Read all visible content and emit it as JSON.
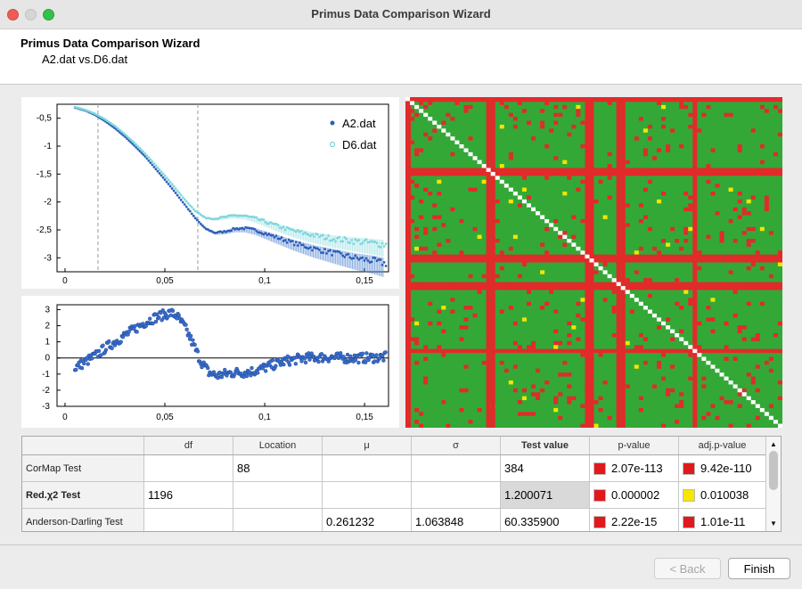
{
  "window": {
    "title": "Primus Data Comparison Wizard"
  },
  "header": {
    "title": "Primus Data Comparison Wizard",
    "subtitle": "A2.dat vs.D6.dat"
  },
  "colors": {
    "a2": "#2c5fb8",
    "d6": "#7fd7dc",
    "residual": "#3a6fcf",
    "map_green": "#33a837",
    "map_red": "#e22a2a",
    "map_yellow": "#f2e500",
    "map_diag": "#ffffff",
    "p_red": "#e0191c",
    "p_yellow": "#f7e600"
  },
  "chart_data": [
    {
      "type": "scatter",
      "title": "",
      "xlabel": "",
      "ylabel": "",
      "xlim": [
        -0.004,
        0.162
      ],
      "ylim": [
        -3.25,
        -0.25
      ],
      "xticks": [
        "0",
        "0,05",
        "0,1",
        "0,15"
      ],
      "yticks": [
        "-0,5",
        "-1",
        "-1,5",
        "-2",
        "-2,5",
        "-3"
      ],
      "vlines": [
        0.0165,
        0.0665
      ],
      "legend": "top-right",
      "series": [
        {
          "name": "A2.dat",
          "points": [
            [
              0.005,
              -0.31
            ],
            [
              0.01,
              -0.36
            ],
            [
              0.015,
              -0.44
            ],
            [
              0.02,
              -0.55
            ],
            [
              0.025,
              -0.68
            ],
            [
              0.03,
              -0.83
            ],
            [
              0.035,
              -1.0
            ],
            [
              0.04,
              -1.18
            ],
            [
              0.045,
              -1.39
            ],
            [
              0.05,
              -1.6
            ],
            [
              0.055,
              -1.82
            ],
            [
              0.06,
              -2.05
            ],
            [
              0.065,
              -2.28
            ],
            [
              0.07,
              -2.47
            ],
            [
              0.075,
              -2.55
            ],
            [
              0.08,
              -2.53
            ],
            [
              0.085,
              -2.48
            ],
            [
              0.09,
              -2.47
            ],
            [
              0.095,
              -2.5
            ],
            [
              0.1,
              -2.56
            ],
            [
              0.105,
              -2.62
            ],
            [
              0.11,
              -2.68
            ],
            [
              0.115,
              -2.74
            ],
            [
              0.12,
              -2.79
            ],
            [
              0.125,
              -2.84
            ],
            [
              0.13,
              -2.88
            ],
            [
              0.135,
              -2.92
            ],
            [
              0.14,
              -2.96
            ],
            [
              0.145,
              -3.0
            ],
            [
              0.15,
              -3.03
            ],
            [
              0.155,
              -3.06
            ],
            [
              0.16,
              -3.1
            ]
          ]
        },
        {
          "name": "D6.dat",
          "points": [
            [
              0.005,
              -0.3
            ],
            [
              0.01,
              -0.35
            ],
            [
              0.015,
              -0.42
            ],
            [
              0.02,
              -0.52
            ],
            [
              0.025,
              -0.64
            ],
            [
              0.03,
              -0.79
            ],
            [
              0.035,
              -0.95
            ],
            [
              0.04,
              -1.13
            ],
            [
              0.045,
              -1.33
            ],
            [
              0.05,
              -1.53
            ],
            [
              0.055,
              -1.74
            ],
            [
              0.06,
              -1.96
            ],
            [
              0.065,
              -2.15
            ],
            [
              0.07,
              -2.28
            ],
            [
              0.075,
              -2.3
            ],
            [
              0.08,
              -2.27
            ],
            [
              0.085,
              -2.24
            ],
            [
              0.09,
              -2.25
            ],
            [
              0.095,
              -2.29
            ],
            [
              0.1,
              -2.35
            ],
            [
              0.105,
              -2.41
            ],
            [
              0.11,
              -2.47
            ],
            [
              0.115,
              -2.52
            ],
            [
              0.12,
              -2.56
            ],
            [
              0.125,
              -2.6
            ],
            [
              0.13,
              -2.63
            ],
            [
              0.135,
              -2.66
            ],
            [
              0.14,
              -2.68
            ],
            [
              0.145,
              -2.7
            ],
            [
              0.15,
              -2.72
            ],
            [
              0.155,
              -2.74
            ],
            [
              0.16,
              -2.76
            ]
          ]
        }
      ]
    },
    {
      "type": "scatter",
      "title": "",
      "xlabel": "",
      "ylabel": "",
      "xlim": [
        -0.004,
        0.162
      ],
      "ylim": [
        -3,
        3.3
      ],
      "xticks": [
        "0",
        "0,05",
        "0,1",
        "0,15"
      ],
      "yticks": [
        "3",
        "2",
        "1",
        "0",
        "-1",
        "-2",
        "-3"
      ],
      "series": [
        {
          "points": [
            [
              0.005,
              -0.6
            ],
            [
              0.008,
              -0.4
            ],
            [
              0.012,
              -0.1
            ],
            [
              0.016,
              0.2
            ],
            [
              0.02,
              0.6
            ],
            [
              0.025,
              1.0
            ],
            [
              0.03,
              1.4
            ],
            [
              0.035,
              1.8
            ],
            [
              0.04,
              2.2
            ],
            [
              0.045,
              2.5
            ],
            [
              0.05,
              2.7
            ],
            [
              0.053,
              2.8
            ],
            [
              0.056,
              2.6
            ],
            [
              0.06,
              1.9
            ],
            [
              0.064,
              0.9
            ],
            [
              0.068,
              -0.2
            ],
            [
              0.072,
              -0.9
            ],
            [
              0.076,
              -1.1
            ],
            [
              0.08,
              -1.0
            ],
            [
              0.085,
              -0.9
            ],
            [
              0.09,
              -0.9
            ],
            [
              0.095,
              -0.8
            ],
            [
              0.1,
              -0.6
            ],
            [
              0.105,
              -0.4
            ],
            [
              0.11,
              -0.2
            ],
            [
              0.115,
              -0.1
            ],
            [
              0.12,
              0.0
            ],
            [
              0.13,
              0.05
            ],
            [
              0.14,
              0.0
            ],
            [
              0.15,
              0.0
            ],
            [
              0.16,
              0.05
            ]
          ]
        }
      ]
    },
    {
      "type": "heatmap",
      "title": "",
      "n": 84,
      "red_lines": [
        2,
        18,
        19,
        40,
        41,
        47,
        48,
        64,
        77,
        78,
        98
      ],
      "red_cols": [
        18,
        19,
        40,
        41,
        47,
        48,
        64
      ]
    },
    {
      "type": "table",
      "columns": [
        "",
        "df",
        "Location",
        "μ",
        "σ",
        "Test value",
        "p-value",
        "adj.p-value"
      ],
      "rows": [
        {
          "label": "CorMap Test",
          "bold": false,
          "df": "",
          "location": "88",
          "mu": "",
          "sigma": "",
          "test_value": "384",
          "test_value_highlight": false,
          "p_value": "2.07e-113",
          "p_color": "red",
          "adj_p_value": "9.42e-110",
          "adj_color": "red"
        },
        {
          "label": "Red.χ2 Test",
          "bold": true,
          "df": "1196",
          "location": "",
          "mu": "",
          "sigma": "",
          "test_value": "1.200071",
          "test_value_highlight": true,
          "p_value": "0.000002",
          "p_color": "red",
          "adj_p_value": "0.010038",
          "adj_color": "yellow"
        },
        {
          "label": "Anderson-Darling Test",
          "bold": false,
          "df": "",
          "location": "",
          "mu": "0.261232",
          "sigma": "1.063848",
          "test_value": "60.335900",
          "test_value_highlight": false,
          "p_value": "2.22e-15",
          "p_color": "red",
          "adj_p_value": "1.01e-11",
          "adj_color": "red"
        }
      ]
    }
  ],
  "buttons": {
    "back": "< Back",
    "finish": "Finish"
  }
}
